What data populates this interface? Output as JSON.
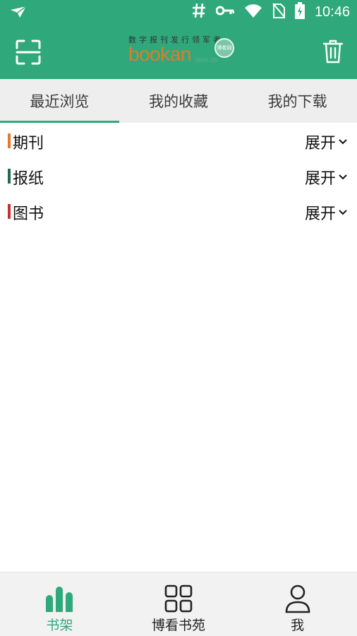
{
  "status_bar": {
    "time": "10:46",
    "icons": [
      "send-icon",
      "hash-icon",
      "key-icon",
      "wifi-icon",
      "no-sim-icon",
      "battery-charging-icon"
    ]
  },
  "app_bar": {
    "logo": {
      "tagline": "数字报刊发行领军者",
      "brand": "bookan",
      "domain": ".com.cn",
      "badge": "博看网"
    },
    "left_icon": "scan-icon",
    "right_icon": "trash-icon"
  },
  "tabs": [
    {
      "label": "最近浏览",
      "active": true
    },
    {
      "label": "我的收藏",
      "active": false
    },
    {
      "label": "我的下载",
      "active": false
    }
  ],
  "categories": [
    {
      "label": "期刊",
      "expand_label": "展开",
      "accent": "#e07a2e"
    },
    {
      "label": "报纸",
      "expand_label": "展开",
      "accent": "#1f6b4e"
    },
    {
      "label": "图书",
      "expand_label": "展开",
      "accent": "#c8302e"
    }
  ],
  "bottom_nav": [
    {
      "label": "书架",
      "icon": "bookshelf-icon",
      "active": true
    },
    {
      "label": "博看书苑",
      "icon": "grid-icon",
      "active": false
    },
    {
      "label": "我",
      "icon": "user-icon",
      "active": false
    }
  ],
  "colors": {
    "primary": "#2fa87c",
    "tab_bg": "#eeeeee",
    "nav_active": "#2fa87c",
    "nav_inactive": "#222222"
  }
}
